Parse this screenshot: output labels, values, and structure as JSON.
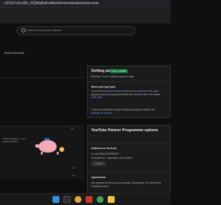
{
  "browser": {
    "url": "...UC0x7xScZEi_XQMqBsEuMohA/monetization/overview"
  },
  "header": {
    "search_placeholder": "Search across your channel"
  },
  "content": {
    "shorts_label": "Shorts Feed ads",
    "left_card_text": "...different ways to ...ns to receive your first..."
  },
  "getting_paid": {
    "title": "Getting paid",
    "badge": "Setup complete",
    "next_step": "Next step: You've completed payment setup",
    "when_title": "When you'll get paid",
    "when_text_1": "If you meet the",
    "when_link_1": "payment threshold",
    "when_text_2": "and have no",
    "when_link_2": "payment holds",
    "when_text_3": ", you'll typically receive your payment between the 21st and 26th of the month.",
    "learn_more": "Learn more",
    "view_text": "To view your finalised monthly earnings and payment details, visit",
    "adsense_link": "AdSense for YouTube"
  },
  "ypp": {
    "title": "YouTube Partner Programme options",
    "adsense_label": "AdSense for YouTube",
    "id_text": "ID: pub-9954611693962930",
    "associated_text": "Associated on 7 September 2022 at 08:25",
    "change_button": "Change",
    "agreements_title": "Agreements",
    "agreements_text": "See agreements that you have accepted, including the YouTube Partner Programme terms"
  },
  "taskbar": {
    "icons": [
      "windows-icon",
      "search-icon",
      "browser-icon",
      "app-icon",
      "chrome-icon",
      "folder-icon"
    ]
  }
}
